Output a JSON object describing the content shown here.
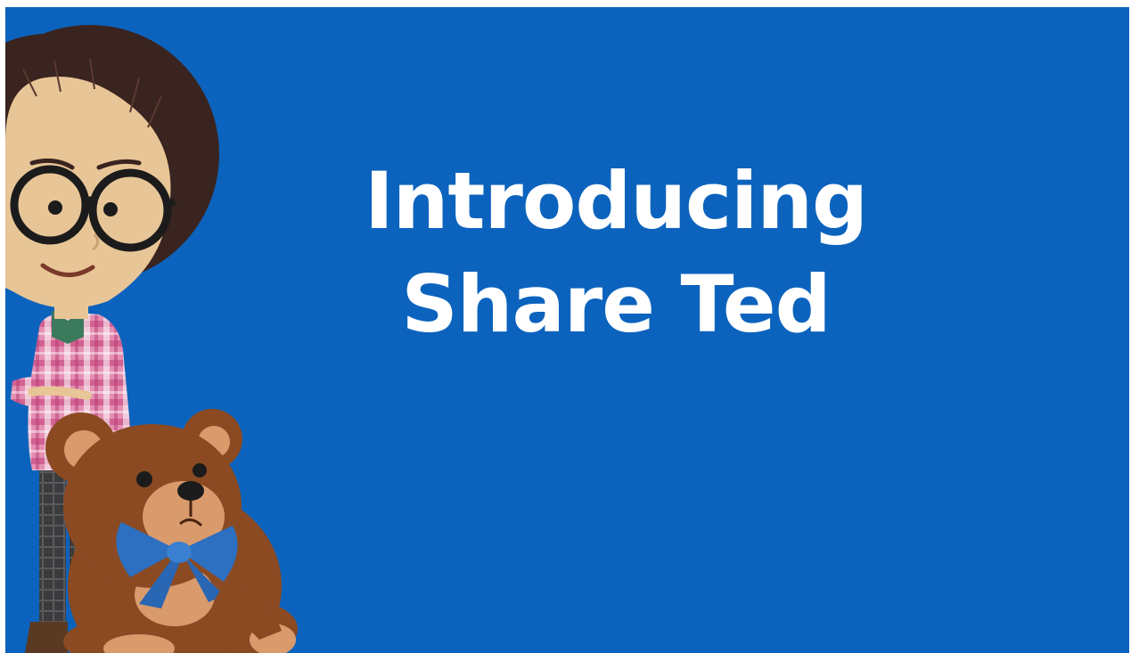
{
  "slide": {
    "background_color": "#0c63bd",
    "title_line_1": "Introducing",
    "title_line_2": "Share Ted"
  },
  "illustration": {
    "characters": [
      "girl-with-glasses",
      "teddy-bear"
    ],
    "colors": {
      "hair": "#3a2420",
      "skin": "#e8c596",
      "glasses": "#1b1b1b",
      "shirt": "#e58fb2",
      "bear_fur": "#8b4a22",
      "bear_muzzle": "#d99a6c",
      "bow": "#2d6fc0"
    }
  }
}
